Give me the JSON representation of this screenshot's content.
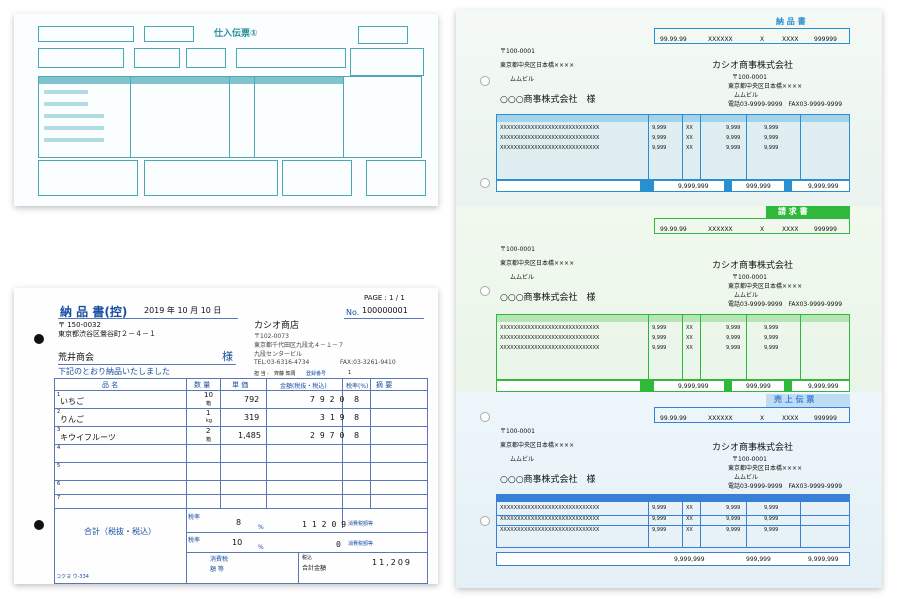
{
  "top_left_form": {
    "title": "仕入伝票①"
  },
  "delivery_slip": {
    "page_label": "PAGE : 1 / 1",
    "title": "納 品 書(控)",
    "date": "2019 年 10 月 10 日",
    "no_prefix": "No.",
    "no_value": "100000001",
    "customer_zip": "〒 150-0032",
    "customer_address": "東京都渋谷区鶯谷町２－４－１",
    "customer_name": "荒井商会",
    "honorific": "様",
    "message": "下記のとおり納品いたしました",
    "company_name": "カシオ商店",
    "company_zip": "〒102-0073",
    "company_address1": "東京都千代田区九段北４－１－７",
    "company_address2": "九段センタービル",
    "company_tel": "TEL:03-6316-4734",
    "company_fax": "FAX:03-3261-9410",
    "tantou": "担 当 :",
    "tantou_name": "齊藤  知周",
    "touroku_label": "登録番号",
    "touroku_value": "1",
    "headers": [
      "品 名",
      "数 量",
      "単 価",
      "金額(税抜・税込)",
      "税率(%)",
      "摘 要"
    ],
    "rows": [
      {
        "no": "1",
        "name": "いちご",
        "qty": "10",
        "unit": "箱",
        "price": "792",
        "amount": "7920",
        "rate": "8"
      },
      {
        "no": "2",
        "name": "りんご",
        "qty": "1",
        "unit": "kg",
        "price": "319",
        "amount": "319",
        "rate": "8"
      },
      {
        "no": "3",
        "name": "キウイフルーツ",
        "qty": "2",
        "unit": "箱",
        "price": "1,485",
        "amount": "2970",
        "rate": "8"
      },
      {
        "no": "4",
        "name": "",
        "qty": "",
        "unit": "",
        "price": "",
        "amount": "",
        "rate": ""
      },
      {
        "no": "5",
        "name": "",
        "qty": "",
        "unit": "",
        "price": "",
        "amount": "",
        "rate": ""
      },
      {
        "no": "6",
        "name": "",
        "qty": "",
        "unit": "",
        "price": "",
        "amount": "",
        "rate": ""
      },
      {
        "no": "7",
        "name": "",
        "qty": "",
        "unit": "",
        "price": "",
        "amount": "",
        "rate": ""
      }
    ],
    "total_label": "合計（税抜・税込）",
    "rate_label": "税率",
    "rate1": "8",
    "rate2": "10",
    "percent": "%",
    "subtotal": "11209",
    "sub2": "0",
    "tax_label": "消費税額等",
    "tax_label2": "消費税額等",
    "consumption_tax_label": "消費税",
    "consumption_tax_label2": "額 等",
    "total_amount_label1": "税込",
    "total_amount_label2": "合計金額",
    "total_amount": "11,209",
    "footer_code": "コクヨ ウ-334"
  },
  "right_forms": [
    {
      "title": "納 品 書",
      "header_cells": [
        "99.99.99",
        "XXXXXX",
        "X",
        "XXXX",
        "999999"
      ],
      "zip": "〒100-0001",
      "address": "東京都中央区日本橋××××",
      "building": "ムムビル",
      "customer": "○○○商事株式会社　様",
      "company": "カシオ商事株式会社",
      "company_zip": "〒100-0001",
      "company_address": "東京都中央区日本橋××××",
      "company_building": "ムムビル",
      "company_tel": "電話03-9999-9999　FAX03-9999-9999",
      "lines": [
        "XXXXXXXXXXXXXXXXXXXXXXXXXXXXX",
        "XXXXXXXXXXXXXXXXXXXXXXXXXXXXX",
        "XXXXXXXXXXXXXXXXXXXXXXXXXXXXX"
      ],
      "qtys": [
        "9,999",
        "9,999",
        "9,999"
      ],
      "units": [
        "XX",
        "XX",
        "XX"
      ],
      "prices": [
        "9,999",
        "9,999",
        "9,999"
      ],
      "amounts": [
        "9,999",
        "9,999",
        "9,999"
      ],
      "footer_total1": "9,999,999",
      "footer_total2": "999,999",
      "footer_total3": "9,999,999",
      "accent": "#2a8fd0"
    },
    {
      "title": "請 求 書",
      "header_cells": [
        "99.99.99",
        "XXXXXX",
        "X",
        "XXXX",
        "999999"
      ],
      "zip": "〒100-0001",
      "address": "東京都中央区日本橋××××",
      "building": "ムムビル",
      "customer": "○○○商事株式会社　様",
      "company": "カシオ商事株式会社",
      "company_zip": "〒100-0001",
      "company_address": "東京都中央区日本橋××××",
      "company_building": "ムムビル",
      "company_tel": "電話03-9999-9999　FAX03-9999-9999",
      "lines": [
        "XXXXXXXXXXXXXXXXXXXXXXXXXXXXX",
        "XXXXXXXXXXXXXXXXXXXXXXXXXXXXX",
        "XXXXXXXXXXXXXXXXXXXXXXXXXXXXX"
      ],
      "qtys": [
        "9,999",
        "9,999",
        "9,999"
      ],
      "units": [
        "XX",
        "XX",
        "XX"
      ],
      "prices": [
        "9,999",
        "9,999",
        "9,999"
      ],
      "amounts": [
        "9,999",
        "9,999",
        "9,999"
      ],
      "footer_total1": "9,999,999",
      "footer_total2": "999,999",
      "footer_total3": "9,999,999",
      "accent": "#2fb83a"
    },
    {
      "title": "売 上 伝 票",
      "header_cells": [
        "99.99.99",
        "XXXXXX",
        "X",
        "XXXX",
        "999999"
      ],
      "zip": "〒100-0001",
      "address": "東京都中央区日本橋××××",
      "building": "ムムビル",
      "customer": "○○○商事株式会社　様",
      "company": "カシオ商事株式会社",
      "company_zip": "〒100-0001",
      "company_address": "東京都中央区日本橋××××",
      "company_building": "ムムビル",
      "company_tel": "電話03-9999-9999　FAX03-9999-9999",
      "lines": [
        "XXXXXXXXXXXXXXXXXXXXXXXXXXXXX",
        "XXXXXXXXXXXXXXXXXXXXXXXXXXXXX",
        "XXXXXXXXXXXXXXXXXXXXXXXXXXXXX"
      ],
      "qtys": [
        "9,999",
        "9,999",
        "9,999"
      ],
      "units": [
        "XX",
        "XX",
        "XX"
      ],
      "prices": [
        "9,999",
        "9,999",
        "9,999"
      ],
      "amounts": [
        "9,999",
        "9,999",
        "9,999"
      ],
      "footer_total1": "9,999,999",
      "footer_total2": "999,999",
      "footer_total3": "9,999,999",
      "accent": "#3a7fd6"
    }
  ]
}
